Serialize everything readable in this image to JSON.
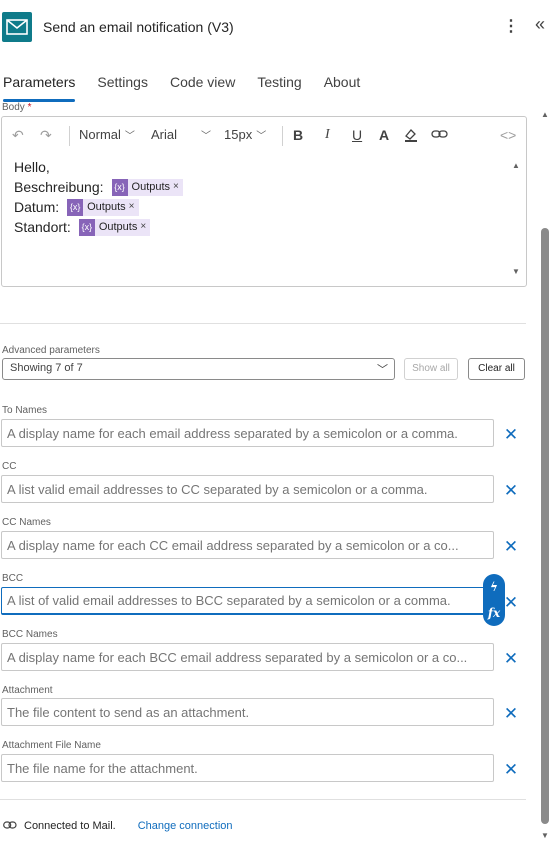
{
  "header": {
    "title": "Send an email notification (V3)",
    "more_icon": "more-vertical-icon",
    "collapse_icon": "double-chevron-left-icon",
    "app_icon": "mail-icon",
    "accent": "#0f7b8a"
  },
  "tabs": [
    {
      "label": "Parameters",
      "active": true
    },
    {
      "label": "Settings",
      "active": false
    },
    {
      "label": "Code view",
      "active": false
    },
    {
      "label": "Testing",
      "active": false
    },
    {
      "label": "About",
      "active": false
    }
  ],
  "body_field": {
    "label": "Body",
    "required_mark": "*",
    "toolbar": {
      "paragraph_style": "Normal",
      "font": "Arial",
      "font_size": "15px",
      "bold": "B",
      "italic": "I",
      "underline": "U",
      "font_color": "A"
    },
    "lines": [
      {
        "text": "Hello,",
        "token": null
      },
      {
        "text": "Beschreibung:",
        "token": "Outputs"
      },
      {
        "text": "Datum:",
        "token": "Outputs"
      },
      {
        "text": "Standort:",
        "token": "Outputs"
      }
    ]
  },
  "advanced": {
    "label": "Advanced parameters",
    "selected": "Showing 7 of 7",
    "show_all": "Show all",
    "clear_all": "Clear all"
  },
  "fields": [
    {
      "label": "To Names",
      "placeholder": "A display name for each email address separated by a semicolon or a comma."
    },
    {
      "label": "CC",
      "placeholder": "A list valid email addresses to CC separated by a semicolon or a comma."
    },
    {
      "label": "CC Names",
      "placeholder": "A display name for each CC email address separated by a semicolon or a co..."
    },
    {
      "label": "BCC",
      "placeholder": "A list of valid email addresses to BCC separated by a semicolon or a comma."
    },
    {
      "label": "BCC Names",
      "placeholder": "A display name for each BCC email address separated by a semicolon or a co..."
    },
    {
      "label": "Attachment",
      "placeholder": "The file content to send as an attachment."
    },
    {
      "label": "Attachment File Name",
      "placeholder": "The file name for the attachment."
    }
  ],
  "footer": {
    "connected": "Connected to Mail.",
    "change": "Change connection"
  },
  "colors": {
    "primary": "#0f6cbd",
    "token_bg": "#ebe4f7",
    "token_icon": "#8764b8"
  }
}
